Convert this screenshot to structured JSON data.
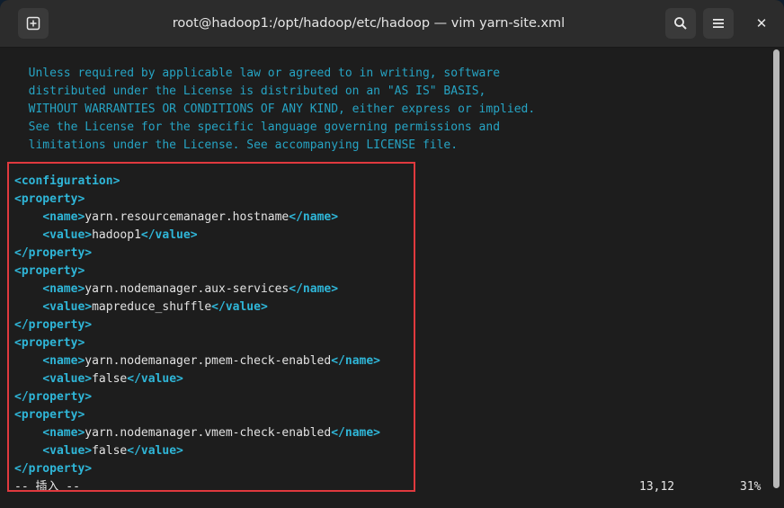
{
  "window": {
    "title": "root@hadoop1:/opt/hadoop/etc/hadoop — vim yarn-site.xml"
  },
  "titlebar": {
    "new_tab_icon": "new-tab-icon",
    "search_icon": "search-icon",
    "menu_icon": "hamburger-menu-icon",
    "close_label": "✕"
  },
  "license": [
    "  Unless required by applicable law or agreed to in writing, software",
    "  distributed under the License is distributed on an \"AS IS\" BASIS,",
    "  WITHOUT WARRANTIES OR CONDITIONS OF ANY KIND, either express or implied.",
    "  See the License for the specific language governing permissions and",
    "  limitations under the License. See accompanying LICENSE file."
  ],
  "comment_end": "-->",
  "config": {
    "open": "<configuration>",
    "properties": [
      {
        "name": "yarn.resourcemanager.hostname",
        "value": "hadoop1"
      },
      {
        "name": "yarn.nodemanager.aux-services",
        "value": "mapreduce_shuffle"
      },
      {
        "name": "yarn.nodemanager.pmem-check-enabled",
        "value": "false"
      },
      {
        "name": "yarn.nodemanager.vmem-check-enabled",
        "value": "false"
      }
    ],
    "tags": {
      "property_open": "<property>",
      "property_close": "</property>",
      "name_open": "<name>",
      "name_close": "</name>",
      "value_open": "<value>",
      "value_close": "</value>"
    }
  },
  "status": {
    "mode": "-- 插入 --",
    "position": "13,12",
    "percent": "31%"
  },
  "colors": {
    "tag": "#2fb6d8",
    "comment": "#26a4c4",
    "highlight": "#e0393e"
  }
}
